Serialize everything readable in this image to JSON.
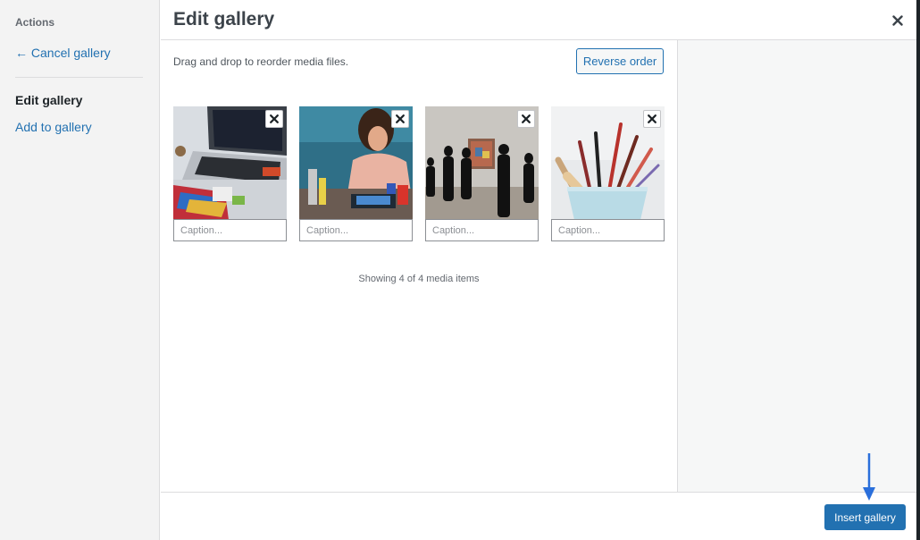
{
  "sidebar": {
    "heading": "Actions",
    "cancel_link": "← Cancel gallery",
    "current_item": "Edit gallery",
    "add_link": "Add to gallery"
  },
  "header": {
    "title": "Edit gallery",
    "close_icon": "close-icon"
  },
  "toolbar": {
    "instructions": "Drag and drop to reorder media files.",
    "reverse_label": "Reverse order"
  },
  "gallery": {
    "items": [
      {
        "image": "laptop-art-supplies",
        "caption_value": "",
        "caption_placeholder": "Caption..."
      },
      {
        "image": "woman-painting",
        "caption_value": "",
        "caption_placeholder": "Caption..."
      },
      {
        "image": "gallery-visitors",
        "caption_value": "",
        "caption_placeholder": "Caption..."
      },
      {
        "image": "paint-brushes-cup",
        "caption_value": "",
        "caption_placeholder": "Caption..."
      }
    ],
    "count_text": "Showing 4 of 4 media items"
  },
  "footer": {
    "insert_label": "Insert gallery"
  },
  "colors": {
    "accent": "#2271b1",
    "sidebar_bg": "#f3f3f3",
    "pane_bg": "#f6f7f7",
    "annotation_arrow": "#2a6fdb"
  }
}
